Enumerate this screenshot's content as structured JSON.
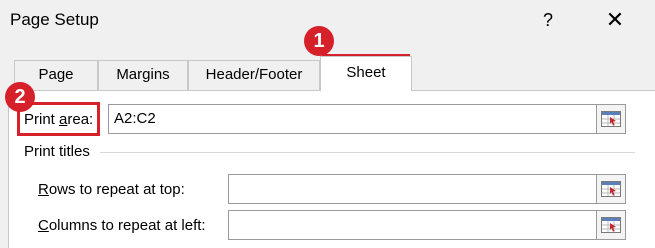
{
  "window": {
    "title": "Page Setup",
    "help_label": "?",
    "close_label": "✕"
  },
  "tabs": [
    {
      "label": "Page"
    },
    {
      "label": "Margins"
    },
    {
      "label": "Header/Footer"
    },
    {
      "label": "Sheet",
      "active": true
    }
  ],
  "print_area": {
    "label_pre": "Print ",
    "label_access": "a",
    "label_post": "rea:",
    "value": "A2:C2"
  },
  "print_titles": {
    "heading": "Print titles",
    "rows": {
      "label_access": "R",
      "label_post": "ows to repeat at top:",
      "value": ""
    },
    "columns": {
      "label_access": "C",
      "label_post": "olumns to repeat at left:",
      "value": ""
    }
  },
  "annotations": {
    "badge_1": "1",
    "badge_2": "2",
    "color": "#d6202a"
  },
  "icons": {
    "picker": "range-picker-icon"
  }
}
